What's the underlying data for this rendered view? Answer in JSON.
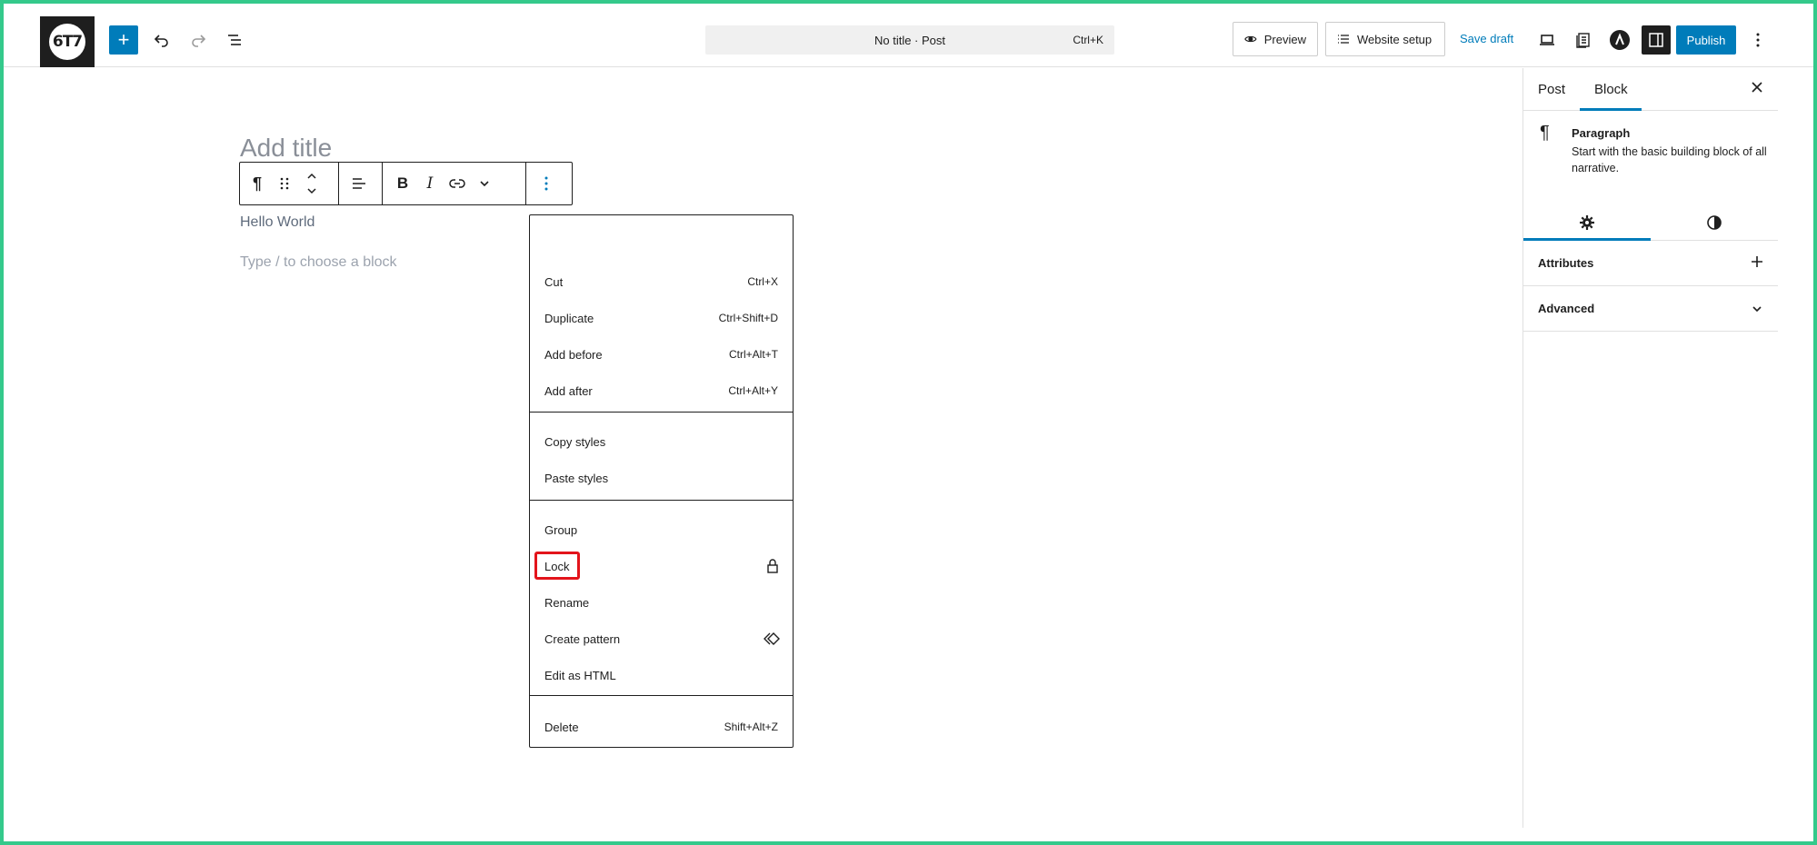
{
  "topbar": {
    "logo_text": "6T7",
    "add_label": "+",
    "command_title": "No title · Post",
    "command_shortcut": "Ctrl+K",
    "preview_label": "Preview",
    "website_setup_label": "Website setup",
    "save_draft_label": "Save draft",
    "publish_label": "Publish"
  },
  "editor": {
    "title_placeholder": "Add title",
    "paragraph_text": "Hello World",
    "block_placeholder": "Type / to choose a block"
  },
  "menu": {
    "items": [
      {
        "label": "Cut",
        "shortcut": "Ctrl+X"
      },
      {
        "label": "Duplicate",
        "shortcut": "Ctrl+Shift+D"
      },
      {
        "label": "Add before",
        "shortcut": "Ctrl+Alt+T"
      },
      {
        "label": "Add after",
        "shortcut": "Ctrl+Alt+Y"
      },
      {
        "label": "Copy styles",
        "shortcut": ""
      },
      {
        "label": "Paste styles",
        "shortcut": ""
      },
      {
        "label": "Group",
        "shortcut": ""
      },
      {
        "label": "Lock",
        "shortcut": "",
        "icon": "lock-icon"
      },
      {
        "label": "Rename",
        "shortcut": ""
      },
      {
        "label": "Create pattern",
        "shortcut": "",
        "icon": "pattern-icon"
      },
      {
        "label": "Edit as HTML",
        "shortcut": ""
      },
      {
        "label": "Delete",
        "shortcut": "Shift+Alt+Z"
      }
    ]
  },
  "sidebar": {
    "tab_post": "Post",
    "tab_block": "Block",
    "block_name": "Paragraph",
    "block_description": "Start with the basic building block of all narrative.",
    "panel_attributes": "Attributes",
    "panel_advanced": "Advanced"
  },
  "colors": {
    "accent": "#007cba",
    "highlight": "#e3141b",
    "frame": "#34c98b"
  }
}
